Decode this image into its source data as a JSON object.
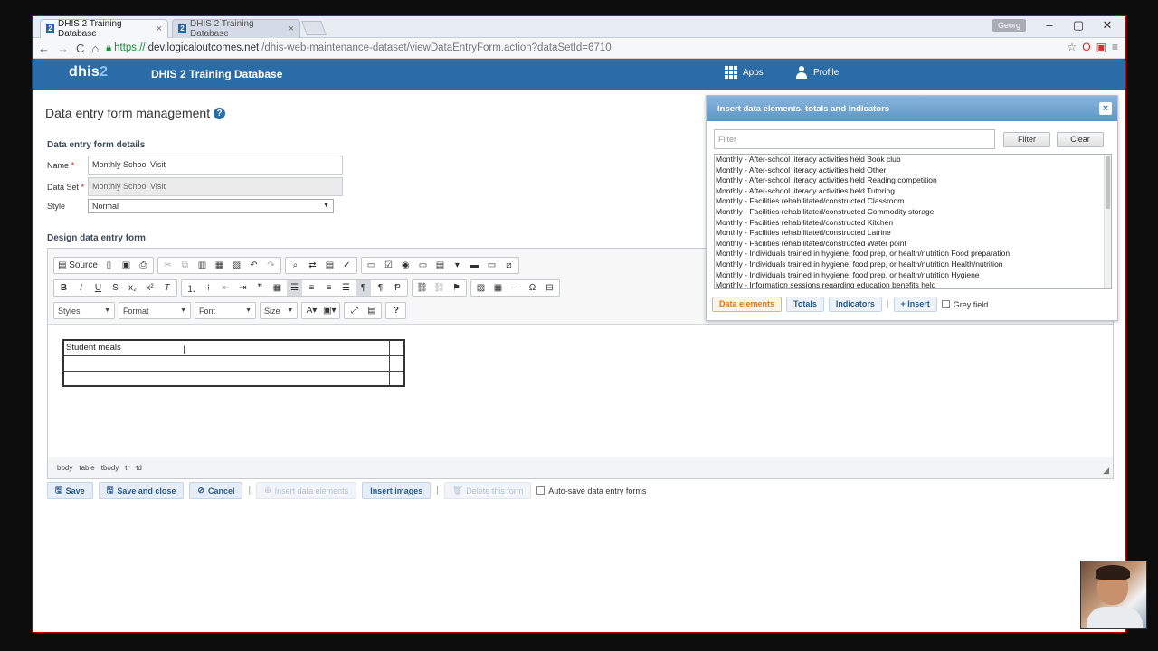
{
  "browser": {
    "tabs": [
      {
        "label": "DHIS 2 Training Database",
        "active": true
      },
      {
        "label": "DHIS 2 Training Database",
        "active": false
      }
    ],
    "user_chip": "Georg",
    "url_protocol": "https://",
    "url_domain": "dev.logicaloutcomes.net",
    "url_path": "/dhis-web-maintenance-dataset/viewDataEntryForm.action?dataSetId=6710"
  },
  "header": {
    "logo_main": "dhis",
    "logo_accent": "2",
    "title": "DHIS 2 Training Database",
    "apps_label": "Apps",
    "profile_label": "Profile",
    "bg_color": "#2a6ca7"
  },
  "main": {
    "page_title": "Data entry form management",
    "details_heading": "Data entry form details",
    "name_label": "Name",
    "name_value": "Monthly School Visit",
    "dataset_label": "Data Set",
    "dataset_value": "Monthly School Visit",
    "style_label": "Style",
    "style_value": "Normal",
    "design_heading": "Design data entry form"
  },
  "editor": {
    "source_label": "Source",
    "combos": {
      "styles": "Styles",
      "format": "Format",
      "font": "Font",
      "size": "Size"
    },
    "table_cell_text": "Student meals",
    "path": [
      "body",
      "table",
      "tbody",
      "tr",
      "td"
    ]
  },
  "buttons": {
    "save": "Save",
    "save_close": "Save and close",
    "cancel": "Cancel",
    "insert_data_elements": "Insert data elements",
    "insert_images": "Insert images",
    "delete_form": "Delete this form",
    "autosave_label": "Auto-save data entry forms"
  },
  "dialog": {
    "title": "Insert data elements, totals and indicators",
    "filter_placeholder": "Filter",
    "filter_btn": "Filter",
    "clear_btn": "Clear",
    "elements": [
      "Monthly - After-school literacy activities held Book club",
      "Monthly - After-school literacy activities held Other",
      "Monthly - After-school literacy activities held Reading competition",
      "Monthly - After-school literacy activities held Tutoring",
      "Monthly - Facilities rehabilitated/constructed Classroom",
      "Monthly - Facilities rehabilitated/constructed Commodity storage",
      "Monthly - Facilities rehabilitated/constructed Kitchen",
      "Monthly - Facilities rehabilitated/constructed Latrine",
      "Monthly - Facilities rehabilitated/constructed Water point",
      "Monthly - Individuals trained in hygiene, food prep, or health/nutrition Food preparation",
      "Monthly - Individuals trained in hygiene, food prep, or health/nutrition Health/nutrition",
      "Monthly - Individuals trained in hygiene, food prep, or health/nutrition Hygiene",
      "Monthly - Information sessions regarding education benefits held"
    ],
    "tab_data_elements": "Data elements",
    "tab_totals": "Totals",
    "tab_indicators": "Indicators",
    "insert_btn": "Insert",
    "grey_field_label": "Grey field"
  }
}
